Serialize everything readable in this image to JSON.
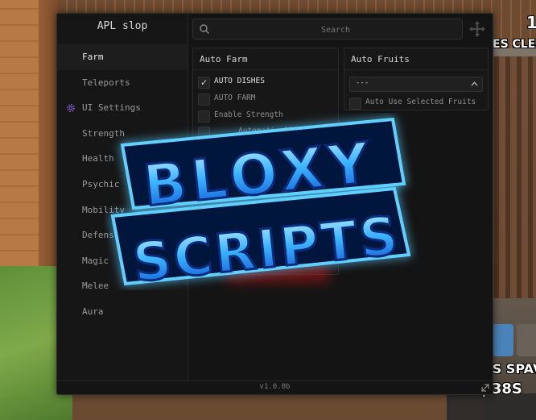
{
  "app": {
    "title": "APL slop",
    "version": "v1.0.0b"
  },
  "search": {
    "placeholder": "Search"
  },
  "sidebar": {
    "items": [
      {
        "label": "Farm",
        "active": true
      },
      {
        "label": "Teleports"
      },
      {
        "label": "UI Settings",
        "icon": "gear-icon"
      },
      {
        "label": "Strength"
      },
      {
        "label": "Health"
      },
      {
        "label": "Psychic"
      },
      {
        "label": "Mobility"
      },
      {
        "label": "Defense"
      },
      {
        "label": "Magic"
      },
      {
        "label": "Melee"
      },
      {
        "label": "Aura"
      }
    ]
  },
  "auto_farm": {
    "title": "Auto Farm",
    "toggles": [
      {
        "label": "AUTO DISHES",
        "checked": true
      },
      {
        "label": "AUTO FARM",
        "checked": false
      },
      {
        "label": "Enable Strength",
        "checked": false
      },
      {
        "label": "Automatically",
        "checked": false
      }
    ]
  },
  "auto_fruits": {
    "title": "Auto Fruits",
    "dropdown_value": "---",
    "toggle_label": "Auto Use Selected Fruits"
  },
  "hud": {
    "top_text": "ES CLEAN",
    "top_number": "1",
    "bottom_line1": "SS SPAV",
    "bottom_line2": "| 38S"
  },
  "watermark": {
    "line1": "BLOXY",
    "line2": "SCRIPTS"
  },
  "colors": {
    "window_bg": "#141414",
    "accent_icon": "#7a5cc9",
    "watermark_blue": "#2aa6ff"
  }
}
